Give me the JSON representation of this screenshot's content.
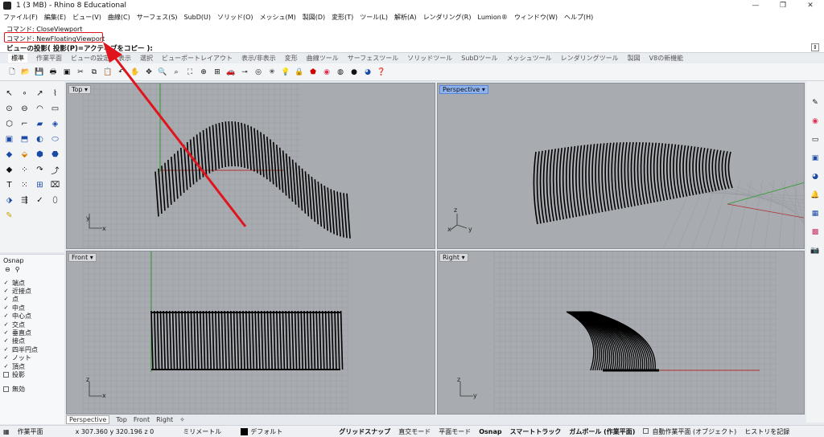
{
  "window": {
    "title": "1 (3 MB) - Rhino 8 Educational",
    "controls": [
      "—",
      "❐",
      "✕"
    ]
  },
  "menu": [
    "ファイル(F)",
    "編集(E)",
    "ビュー(V)",
    "曲線(C)",
    "サーフェス(S)",
    "SubD(U)",
    "ソリッド(O)",
    "メッシュ(M)",
    "製図(D)",
    "変形(T)",
    "ツール(L)",
    "解析(A)",
    "レンダリング(R)",
    "Lumion®",
    "ウィンドウ(W)",
    "ヘルプ(H)"
  ],
  "command": {
    "history1": "コマンド: CloseViewport",
    "history2": "コマンド: NewFloatingViewport",
    "prompt": "ビューの投影( 投影(P)=アクティブをコピー ):"
  },
  "tabs": [
    "標準",
    "作業平面",
    "ビューの設定",
    "表示",
    "選択",
    "ビューポートレイアウト",
    "表示/非表示",
    "変形",
    "曲線ツール",
    "サーフェスツール",
    "ソリッドツール",
    "SubDツール",
    "メッシュツール",
    "レンダリングツール",
    "製図",
    "V8の新機能"
  ],
  "viewports": {
    "top": "Top",
    "perspective": "Perspective",
    "front": "Front",
    "right": "Right"
  },
  "osnap": {
    "title": "Osnap",
    "items": [
      {
        "label": "端点",
        "checked": true
      },
      {
        "label": "近接点",
        "checked": true
      },
      {
        "label": "点",
        "checked": true
      },
      {
        "label": "中点",
        "checked": true
      },
      {
        "label": "中心点",
        "checked": true
      },
      {
        "label": "交点",
        "checked": true
      },
      {
        "label": "垂直点",
        "checked": true
      },
      {
        "label": "接点",
        "checked": true
      },
      {
        "label": "四半円点",
        "checked": true
      },
      {
        "label": "ノット",
        "checked": true
      },
      {
        "label": "頂点",
        "checked": true
      },
      {
        "label": "投影",
        "checked": false
      }
    ],
    "disable_label": "無効"
  },
  "viewport_tabs": [
    "Perspective",
    "Top",
    "Front",
    "Right"
  ],
  "status": {
    "cplane": "作業平面",
    "coords": "x 307.360   y 320.196   z 0",
    "units": "ミリメートル",
    "layer": "デフォルト",
    "grid_snap": "グリッドスナップ",
    "ortho": "直交モード",
    "planar": "平面モード",
    "osnap": "Osnap",
    "smarttrack": "スマートトラック",
    "gumball": "ガムボール (作業平面)",
    "autocplane": "自動作業平面 (オブジェクト)",
    "history": "ヒストリを記録"
  },
  "colors": {
    "annotation": "#e0141c",
    "viewport_bg": "#a8abb0",
    "grid_major": "#8f9399",
    "x_axis": "#b03030",
    "y_axis": "#2e9a2e"
  }
}
